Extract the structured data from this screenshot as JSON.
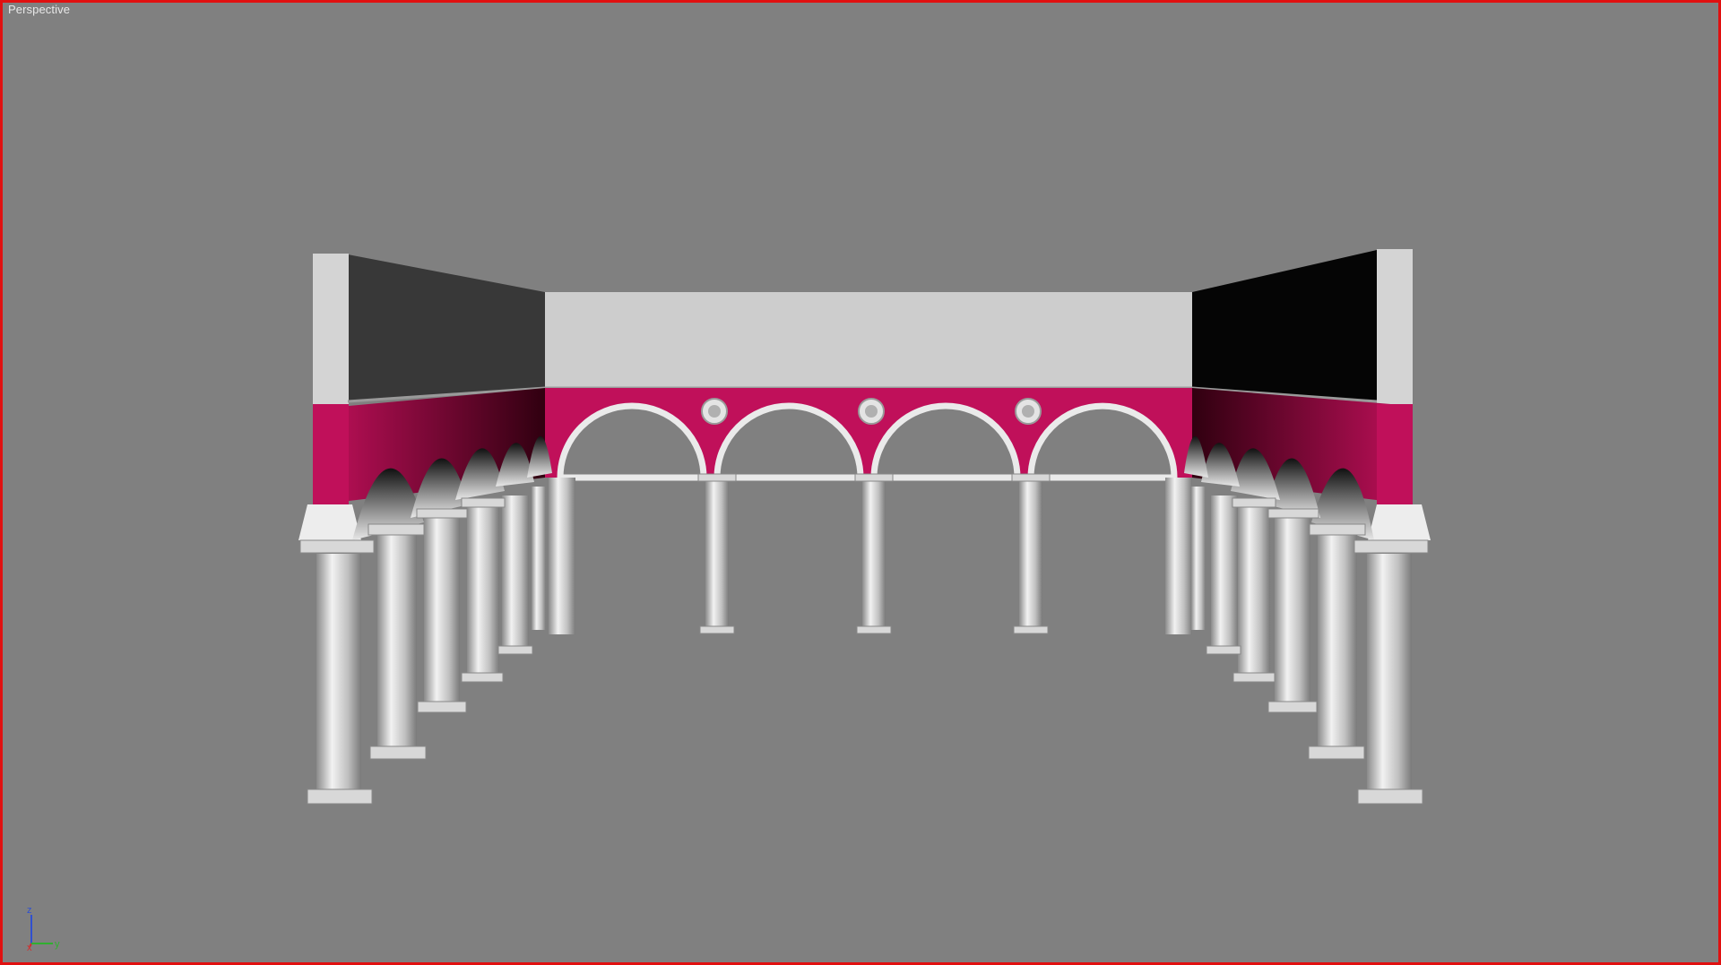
{
  "viewport": {
    "label": "Perspective",
    "border_color": "#e01010",
    "background_color": "#808080",
    "active": true
  },
  "scene": {
    "accent_color": "#c0105a",
    "column_color": "#d8d8d8",
    "wall_light_color": "#cfcfcf",
    "wall_dark_color": "#383838"
  },
  "axis_tripod": {
    "z": "z",
    "x": "x",
    "y": "y",
    "z_color": "#3050d0",
    "x_color": "#d03030",
    "y_color": "#30b030"
  }
}
